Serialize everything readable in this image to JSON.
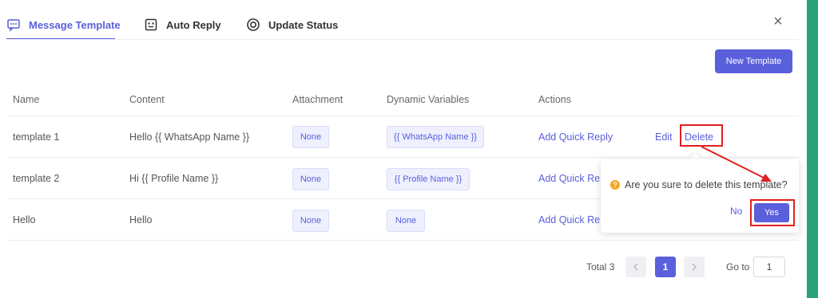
{
  "tabs": [
    {
      "label": "Message Template",
      "icon": "message-template-icon",
      "active": true
    },
    {
      "label": "Auto Reply",
      "icon": "robot-icon",
      "active": false
    },
    {
      "label": "Update Status",
      "icon": "status-ring-icon",
      "active": false
    }
  ],
  "new_template_label": "New Template",
  "table": {
    "headers": [
      "Name",
      "Content",
      "Attachment",
      "Dynamic Variables",
      "Actions"
    ],
    "rows": [
      {
        "name": "template 1",
        "content": "Hello {{ WhatsApp Name }}",
        "attachment": "None",
        "variables": "{{ WhatsApp Name }}",
        "quick_reply": "Add Quick Reply",
        "edit": "Edit",
        "delete": "Delete"
      },
      {
        "name": "template 2",
        "content": "Hi {{ Profile Name }}",
        "attachment": "None",
        "variables": "{{ Profile Name }}",
        "quick_reply": "Add Quick Re"
      },
      {
        "name": "Hello",
        "content": "Hello",
        "attachment": "None",
        "variables": "None",
        "quick_reply": "Add Quick Re"
      }
    ]
  },
  "confirm": {
    "message": "Are you sure to delete this template?",
    "no": "No",
    "yes": "Yes"
  },
  "pagination": {
    "total": "Total 3",
    "current_page": "1",
    "goto_label": "Go to",
    "goto_value": "1"
  },
  "colors": {
    "accent": "#5a5fdc",
    "highlight": "#e02020",
    "side_strip": "#27a27a"
  }
}
